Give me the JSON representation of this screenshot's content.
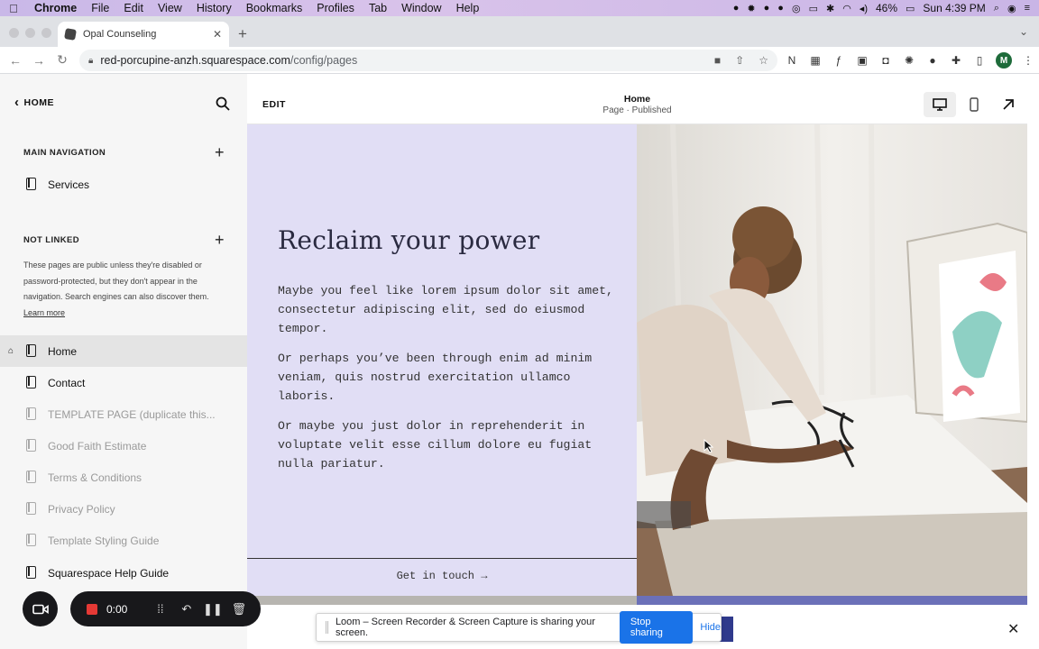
{
  "menubar": {
    "app": "Chrome",
    "items": [
      "File",
      "Edit",
      "View",
      "History",
      "Bookmarks",
      "Profiles",
      "Tab",
      "Window",
      "Help"
    ],
    "battery": "46%",
    "clock": "Sun 4:39 PM"
  },
  "browser": {
    "tab_title": "Opal Counseling",
    "url_host": "red-porcupine-anzh.squarespace.com",
    "url_path": "/config/pages",
    "profile_initial": "M"
  },
  "sidebar": {
    "back_label": "HOME",
    "main_nav_heading": "MAIN NAVIGATION",
    "main_nav_items": [
      "Services"
    ],
    "not_linked_heading": "NOT LINKED",
    "not_linked_desc": "These pages are public unless they're disabled or password-protected, but they don't appear in the navigation. Search engines can also discover them.",
    "learn_more": "Learn more",
    "pages": [
      {
        "label": "Home",
        "state": "active"
      },
      {
        "label": "Contact",
        "state": "normal"
      },
      {
        "label": "TEMPLATE PAGE (duplicate this...",
        "state": "faded"
      },
      {
        "label": "Good Faith Estimate",
        "state": "faded"
      },
      {
        "label": "Terms & Conditions",
        "state": "faded"
      },
      {
        "label": "Privacy Policy",
        "state": "faded"
      },
      {
        "label": "Template Styling Guide",
        "state": "faded"
      },
      {
        "label": "Squarespace Help Guide",
        "state": "normal"
      }
    ]
  },
  "editor": {
    "edit_label": "EDIT",
    "page_title": "Home",
    "page_status": "Page · Published"
  },
  "hero": {
    "title": "Reclaim your power",
    "paragraphs": [
      "Maybe you feel like lorem ipsum dolor sit amet, consectetur adipiscing elit, sed do eiusmod tempor.",
      "Or perhaps you’ve been through enim ad minim veniam, quis nostrud exercitation ullamco laboris.",
      "Or maybe you just dolor in reprehenderit in voluptate velit esse cillum dolore eu fugiat nulla pariatur."
    ],
    "cta": "Get in touch →"
  },
  "loom": {
    "time": "0:00"
  },
  "share_notice": {
    "message": "Loom – Screen Recorder & Screen Capture is sharing your screen.",
    "stop_label": "Stop sharing",
    "hide_label": "Hide"
  },
  "colors": {
    "hero_bg": "#e1def5",
    "accent_blue": "#1a73e8",
    "recording_red": "#e53935",
    "avatar_green": "#1e6b3a"
  }
}
